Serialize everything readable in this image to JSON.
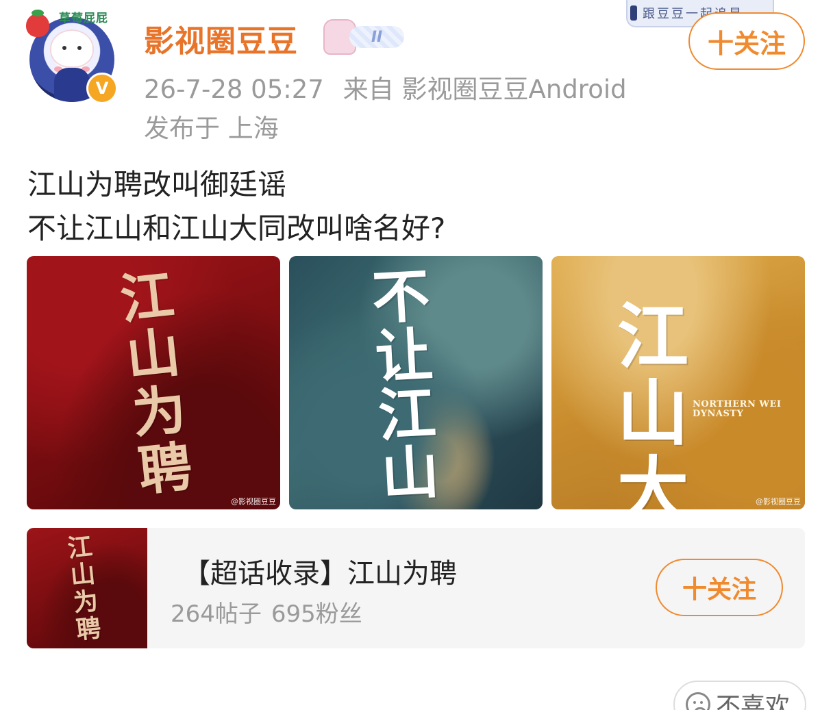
{
  "post": {
    "author": {
      "name": "影视圈豆豆",
      "avatar_badge_text": "草莓屁屁",
      "verified_mark": "V",
      "level_badge": "II"
    },
    "banner_sticker": "跟豆豆一起追星",
    "follow_label": "十关注",
    "timestamp": "26-7-28 05:27",
    "source": "来自 影视圈豆豆Android",
    "location": "发布于 上海",
    "text_lines": [
      "江山为聘改叫御廷谣",
      "不让江山和江山大同改叫啥名好?"
    ],
    "images": [
      {
        "calligraphy": "江山为聘",
        "watermark": "@影视圈豆豆",
        "icon": "poster-image"
      },
      {
        "calligraphy": "不让江山",
        "watermark": "",
        "icon": "poster-image"
      },
      {
        "calligraphy": "江山大同",
        "subtitle": "NORTHERN WEI DYNASTY",
        "watermark": "@影视圈豆豆",
        "icon": "poster-image"
      }
    ]
  },
  "topic_card": {
    "thumb_calligraphy": "江山为聘",
    "title": "【超话收录】江山为聘",
    "posts": "264帖子",
    "fans": "695粉丝",
    "follow_label": "十关注"
  },
  "dislike": {
    "label": "不喜欢",
    "icon": "sad-face-icon"
  },
  "colors": {
    "accent": "#f08a2f",
    "username": "#e8742a",
    "meta_text": "#9a9a9a"
  }
}
